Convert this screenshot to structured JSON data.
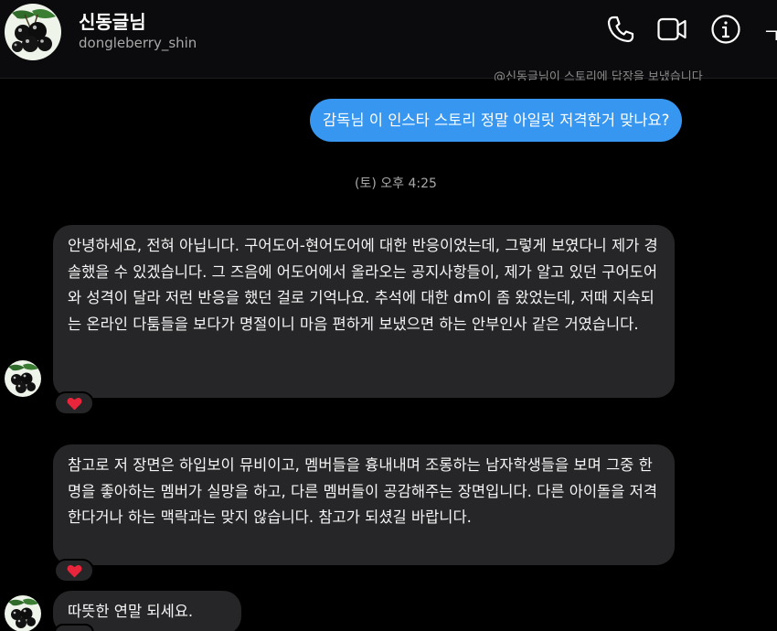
{
  "header": {
    "name": "신동글님",
    "username": "dongleberry_shin",
    "corner_glyph": "ㄱ",
    "icons": [
      "phone-icon",
      "video-camera-icon",
      "info-icon"
    ]
  },
  "thread": {
    "cut_off_note": "@신동글님이 스토리에 답장을 보냈습니다",
    "outgoing_message": "감독님 이 인스타 스토리 정말 아일릿 저격한거 맞나요?",
    "timestamp": "(토) 오후 4:25",
    "incoming_messages": [
      "안녕하세요, 전혀 아닙니다. 구어도어-현어도어에 대한 반응이었는데, 그렇게 보였다니 제가 경솔했을 수 있겠습니다. 그 즈음에 어도어에서 올라오는 공지사항들이, 제가 알고 있던 구어도어와 성격이 달라 저런 반응을 했던 걸로 기억나요. 추석에 대한 dm이 좀 왔었는데, 저때 지속되는 온라인 다툼들을 보다가 명절이니 마음 편하게 보냈으면 하는 안부인사 같은 거였습니다.",
      "참고로 저 장면은 하입보이 뮤비이고, 멤버들을 흉내내며 조롱하는 남자학생들을 보며 그중 한명을 좋아하는 멤버가 실망을 하고, 다른 멤버들이 공감해주는 장면입니다. 다른 아이돌을 저격한다거나 하는 맥락과는 맞지 않습니다. 참고가 되셨길 바랍니다.",
      "따뜻한 연말 되세요."
    ],
    "reaction_icon": "heart-icon"
  },
  "colors": {
    "background": "#000000",
    "outgoing_bubble": "#3797f0",
    "incoming_bubble": "#262629",
    "heart": "#e8253a"
  }
}
